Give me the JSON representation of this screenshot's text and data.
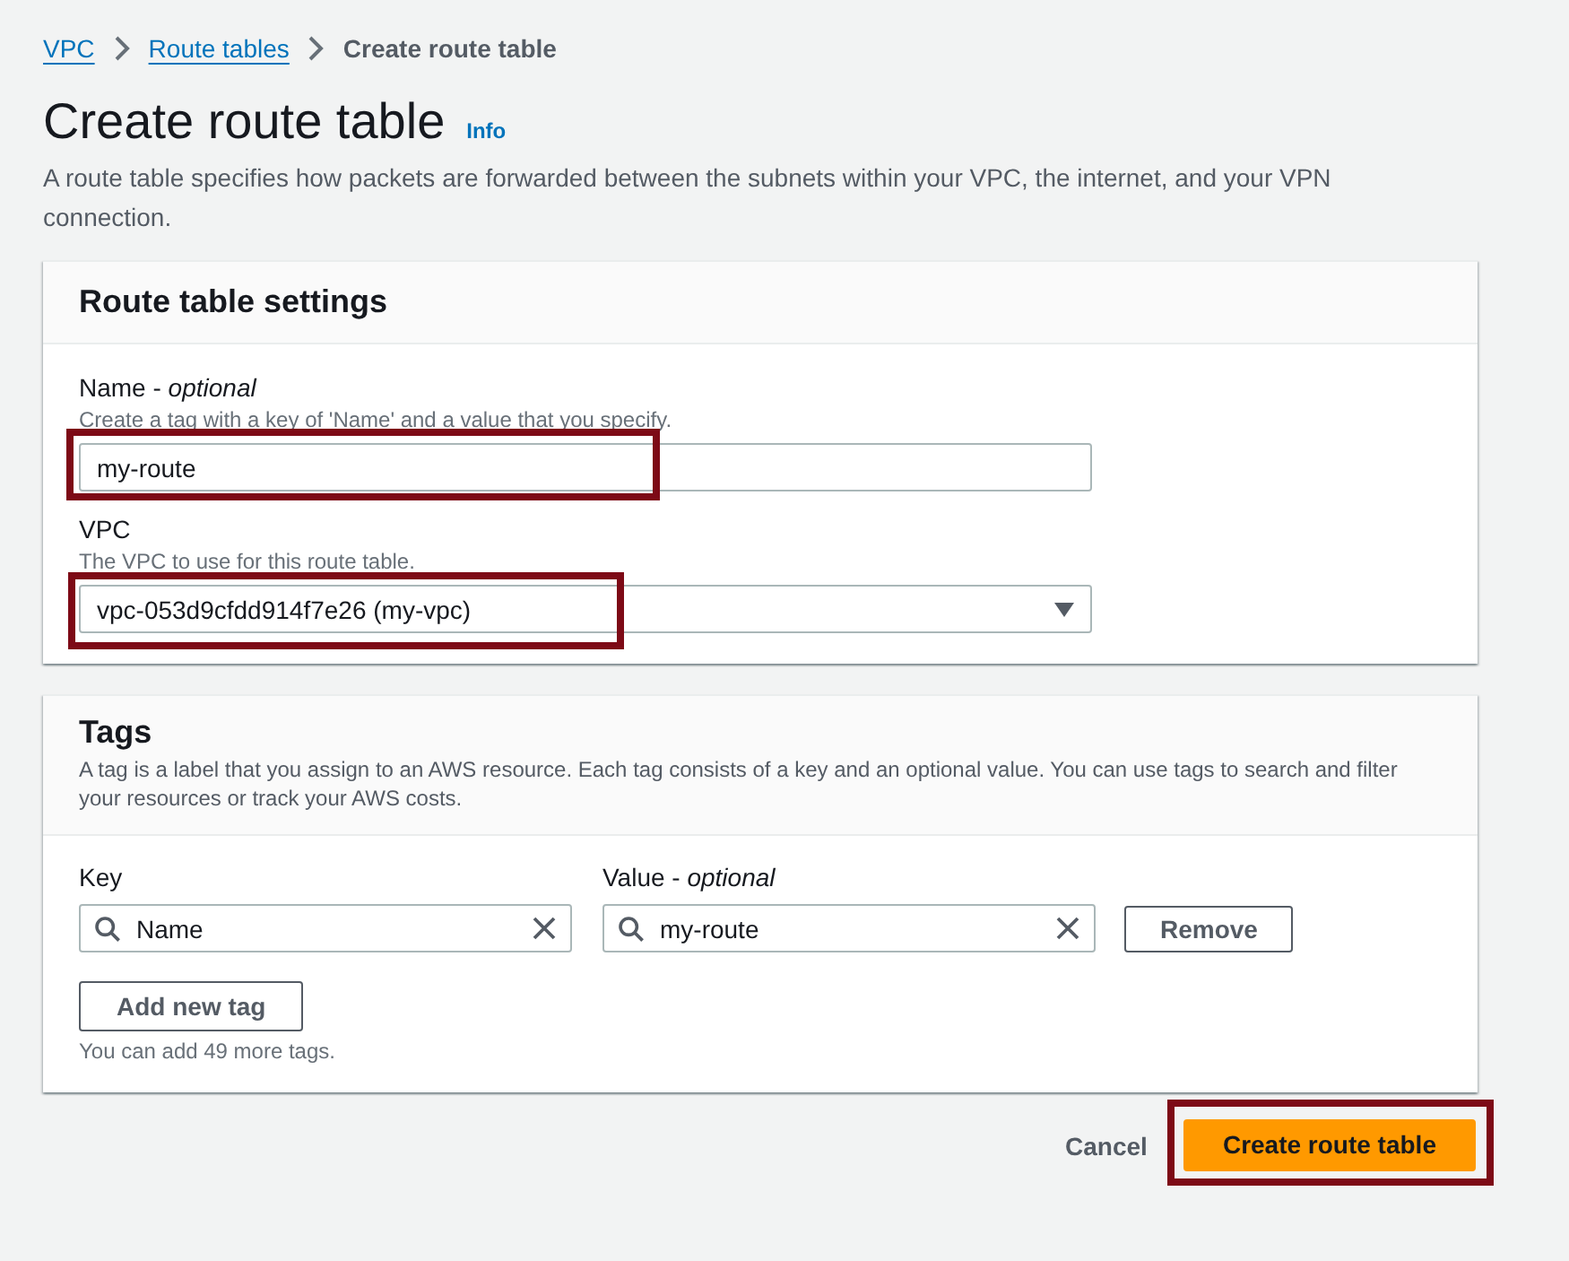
{
  "breadcrumbs": [
    {
      "label": "VPC",
      "kind": "link"
    },
    {
      "label": "Route tables",
      "kind": "link"
    },
    {
      "label": "Create route table",
      "kind": "current"
    }
  ],
  "header": {
    "title": "Create route table",
    "info": "Info",
    "description": "A route table specifies how packets are forwarded between the subnets within your VPC, the internet, and your VPN connection."
  },
  "settings": {
    "title": "Route table settings",
    "fields": [
      {
        "kind": "text",
        "label": "Name - *optional*",
        "description": "Create a tag with a key of 'Name' and a value that you specify.",
        "value": "my-route",
        "highlighted": true
      },
      {
        "kind": "select",
        "label": "VPC",
        "description": "The VPC to use for this route table.",
        "value": "vpc-053d9cfdd914f7e26 (my-vpc)",
        "highlighted": true
      }
    ]
  },
  "tags": {
    "title": "Tags",
    "description": "A tag is a label that you assign to an AWS resource. Each tag consists of a key and an optional value. You can use tags to search and filter your resources or track your AWS costs.",
    "key_label": "Key",
    "value_label": "Value - *optional*",
    "rows": [
      {
        "key": "Name",
        "value": "my-route",
        "remove": "Remove"
      }
    ],
    "add_button": "Add new tag",
    "hint": "You can add 49 more tags."
  },
  "actions": {
    "cancel": "Cancel",
    "submit": {
      "label": "Create route table",
      "highlighted": true
    }
  }
}
